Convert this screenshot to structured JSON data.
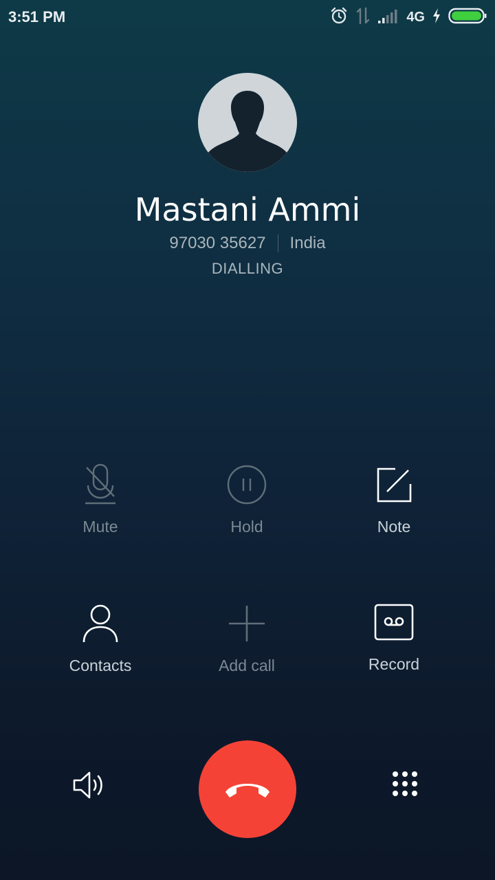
{
  "status_bar": {
    "time": "3:51 PM",
    "network": "4G",
    "icons": [
      "alarm-icon",
      "data-transfer-icon",
      "signal-icon",
      "charging-icon",
      "battery-icon"
    ],
    "battery_color": "#3fcf3f"
  },
  "contact": {
    "name": "Mastani Ammi",
    "number": "97030 35627",
    "location": "India",
    "status": "DIALLING"
  },
  "actions": [
    {
      "label": "Mute",
      "icon": "mute-icon",
      "enabled": false
    },
    {
      "label": "Hold",
      "icon": "hold-icon",
      "enabled": false
    },
    {
      "label": "Note",
      "icon": "note-icon",
      "enabled": true
    },
    {
      "label": "Contacts",
      "icon": "contacts-icon",
      "enabled": true
    },
    {
      "label": "Add call",
      "icon": "add-call-icon",
      "enabled": false
    },
    {
      "label": "Record",
      "icon": "record-icon",
      "enabled": true
    }
  ],
  "bottom_bar": {
    "speaker_icon": "speaker-icon",
    "end_call_icon": "end-call-icon",
    "end_call_color": "#f44336",
    "dialpad_icon": "dialpad-icon"
  }
}
